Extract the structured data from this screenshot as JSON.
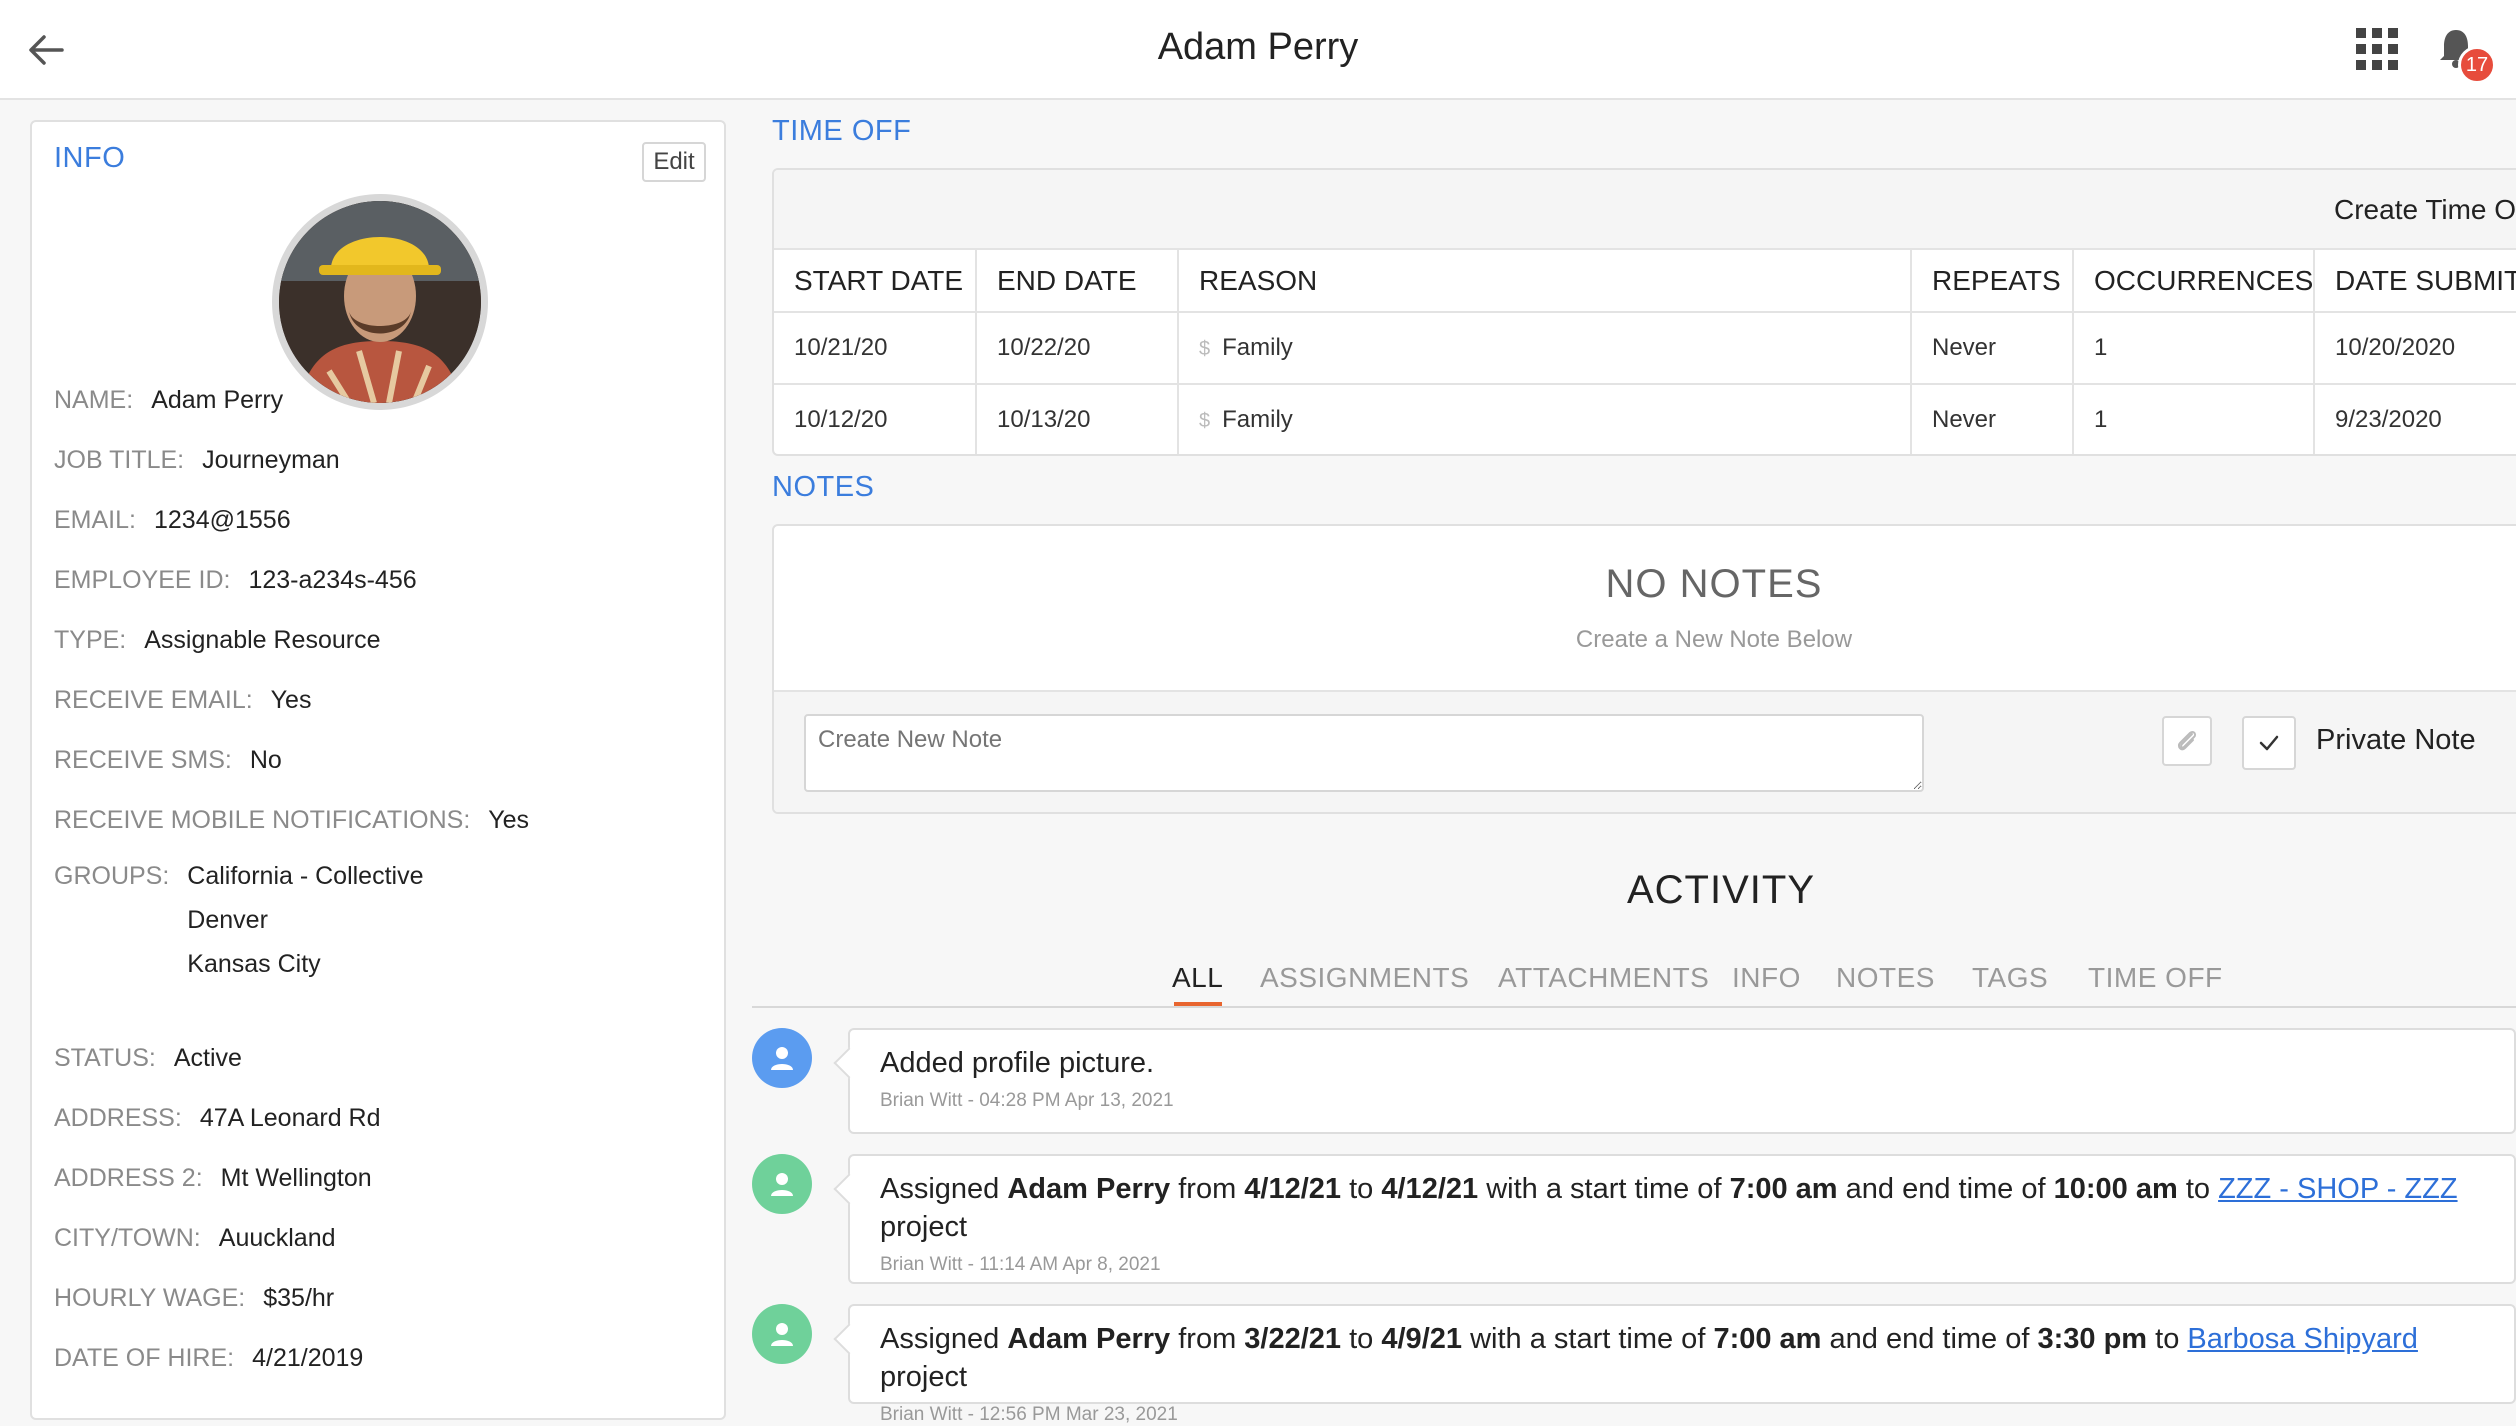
{
  "header": {
    "title": "Adam Perry",
    "notification_count": "17"
  },
  "info": {
    "title": "INFO",
    "edit_label": "Edit",
    "fields": {
      "name": {
        "label": "NAME:",
        "value": "Adam Perry"
      },
      "job_title": {
        "label": "JOB TITLE:",
        "value": "Journeyman"
      },
      "email": {
        "label": "EMAIL:",
        "value": "1234@1556"
      },
      "employee_id": {
        "label": "EMPLOYEE ID:",
        "value": "123-a234s-456"
      },
      "type": {
        "label": "TYPE:",
        "value": "Assignable Resource"
      },
      "receive_email": {
        "label": "RECEIVE EMAIL:",
        "value": "Yes"
      },
      "receive_sms": {
        "label": "RECEIVE SMS:",
        "value": "No"
      },
      "receive_mobile": {
        "label": "RECEIVE MOBILE NOTIFICATIONS:",
        "value": "Yes"
      },
      "groups": {
        "label": "GROUPS:",
        "values": [
          "California - Collective",
          "Denver",
          "Kansas City"
        ]
      },
      "status": {
        "label": "STATUS:",
        "value": "Active"
      },
      "address": {
        "label": "ADDRESS:",
        "value": "47A Leonard Rd"
      },
      "address2": {
        "label": "ADDRESS 2:",
        "value": "Mt Wellington"
      },
      "city": {
        "label": "CITY/TOWN:",
        "value": "Auuckland"
      },
      "hourly_wage": {
        "label": "HOURLY WAGE:",
        "value": "$35/hr"
      },
      "date_of_hire": {
        "label": "DATE OF HIRE:",
        "value": "4/21/2019"
      }
    }
  },
  "time_off": {
    "title": "TIME OFF",
    "create_label": "Create Time O",
    "columns": [
      "START DATE",
      "END DATE",
      "REASON",
      "REPEATS",
      "OCCURRENCES",
      "DATE SUBMIT"
    ],
    "rows": [
      [
        "10/21/20",
        "10/22/20",
        "Family",
        "Never",
        "1",
        "10/20/2020"
      ],
      [
        "10/12/20",
        "10/13/20",
        "Family",
        "Never",
        "1",
        "9/23/2020"
      ]
    ]
  },
  "notes": {
    "title": "NOTES",
    "empty_title": "NO NOTES",
    "empty_sub": "Create a New Note Below",
    "input_placeholder": "Create New Note",
    "private_label": "Private Note"
  },
  "activity": {
    "title": "ACTIVITY",
    "tabs": [
      "ALL",
      "ASSIGNMENTS",
      "ATTACHMENTS",
      "INFO",
      "NOTES",
      "TAGS",
      "TIME OFF"
    ],
    "items": [
      {
        "text": "Added profile picture.",
        "meta": "Brian Witt - 04:28 PM Apr 13, 2021"
      },
      {
        "p1": "Assigned ",
        "name": "Adam Perry",
        "p2": " from ",
        "from": "4/12/21",
        "p3": " to ",
        "to": "4/12/21",
        "p4": " with a start time of ",
        "start": "7:00 am",
        "p5": " and end time of ",
        "end": "10:00 am",
        "p6": " to ",
        "link": "ZZZ - SHOP - ZZZ",
        "p7": " project",
        "meta": "Brian Witt - 11:14 AM Apr 8, 2021"
      },
      {
        "p1": "Assigned ",
        "name": "Adam Perry",
        "p2": " from ",
        "from": "3/22/21",
        "p3": " to ",
        "to": "4/9/21",
        "p4": " with a start time of ",
        "start": "7:00 am",
        "p5": " and end time of ",
        "end": "3:30 pm",
        "p6": " to ",
        "link": "Barbosa Shipyard",
        "p7": " project",
        "meta": "Brian Witt - 12:56 PM Mar 23, 2021"
      }
    ]
  },
  "colors": {
    "accent": "#3b7ddd",
    "tab_active": "#e8652f",
    "avatar_blue": "#5b9cf0",
    "avatar_green": "#6fd19a",
    "badge": "#e74c3c"
  }
}
